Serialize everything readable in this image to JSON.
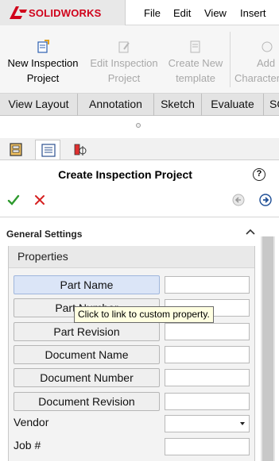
{
  "app": {
    "logo_text": "SOLIDWORKS",
    "menu": [
      "File",
      "Edit",
      "View",
      "Insert"
    ]
  },
  "ribbon": {
    "buttons": [
      {
        "label_line1": "New Inspection",
        "label_line2": "Project",
        "enabled": true
      },
      {
        "label_line1": "Edit Inspection",
        "label_line2": "Project",
        "enabled": false
      },
      {
        "label_line1": "Create New",
        "label_line2": "template",
        "enabled": false
      },
      {
        "label_line1": "Add",
        "label_line2": "Character",
        "enabled": false
      }
    ]
  },
  "tabs": [
    "View Layout",
    "Annotation",
    "Sketch",
    "Evaluate",
    "SO"
  ],
  "panel": {
    "title": "Create Inspection Project",
    "help": "?",
    "section_title": "General Settings",
    "group_title": "Properties",
    "property_buttons": [
      "Part Name",
      "Part Number",
      "Part Revision",
      "Document Name",
      "Document Number",
      "Document Revision"
    ],
    "property_values": [
      "",
      "",
      "",
      "",
      "",
      ""
    ],
    "vendor_label": "Vendor",
    "vendor_value": "",
    "job_label": "Job #",
    "job_value": ""
  },
  "tooltip": "Click to link to custom property.",
  "colors": {
    "brand": "#d0021b",
    "ok_green": "#2e9a2e",
    "cancel_red": "#d62020",
    "active_button": "#dbe5f7",
    "tooltip_bg": "#ffffe1"
  }
}
